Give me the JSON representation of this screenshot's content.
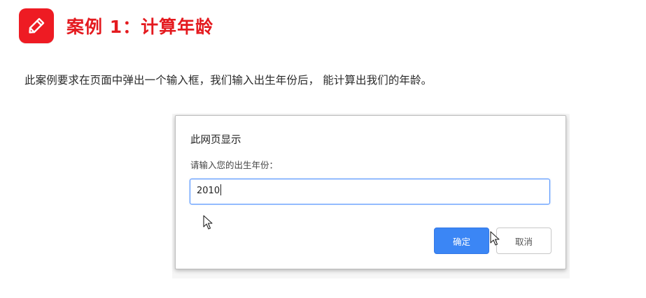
{
  "header": {
    "icon": "pencil-icon",
    "badge_color": "#ee1b23",
    "title": "案例 1：计算年龄",
    "title_color": "#e41a1f"
  },
  "description": "此案例要求在页面中弹出一个输入框，我们输入出生年份后， 能计算出我们的年龄。",
  "dialog": {
    "title": "此网页显示",
    "message": "请输入您的出生年份：",
    "input_value": "2010",
    "ok_label": "确定",
    "cancel_label": "取消",
    "ok_color": "#3b86f5",
    "focus_color": "#4d90fe"
  },
  "cursors": [
    "arrow-cursor-icon",
    "arrow-cursor-icon"
  ]
}
